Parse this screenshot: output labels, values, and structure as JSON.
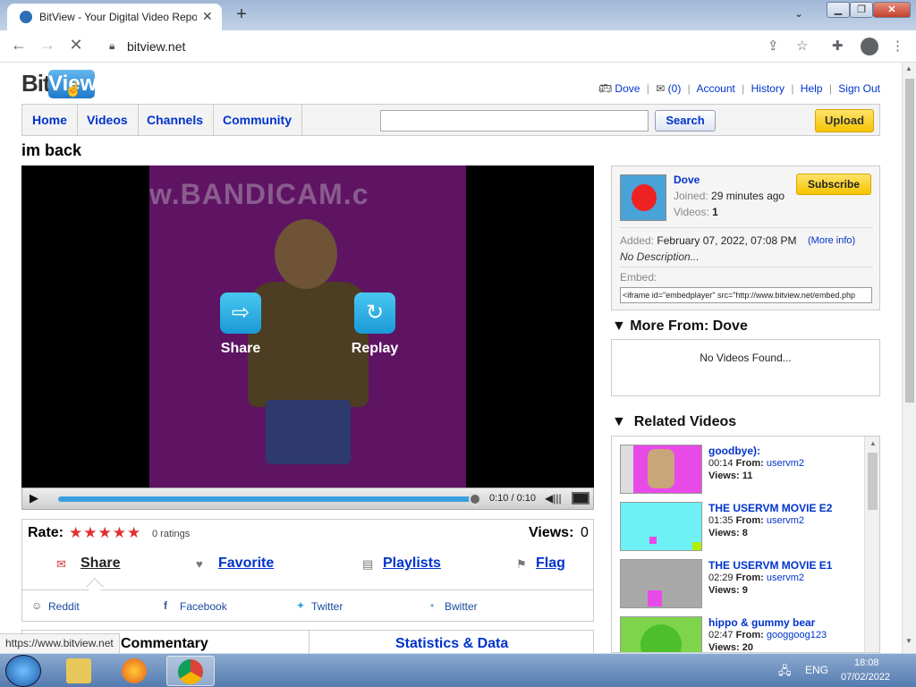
{
  "browser": {
    "tab_title": "BitView - Your Digital Video Repo",
    "url": "bitview.net",
    "status_url": "https://www.bitview.net"
  },
  "header": {
    "logo_bit": "Bit",
    "logo_view": "View",
    "username": "Dove",
    "messages": "(0)",
    "links": [
      "Account",
      "History",
      "Help",
      "Sign Out"
    ]
  },
  "nav": {
    "items": [
      "Home",
      "Videos",
      "Channels",
      "Community"
    ],
    "search_label": "Search",
    "search_value": "",
    "upload_label": "Upload"
  },
  "video": {
    "title": "im back",
    "watermark": "w.BANDICAM.c",
    "overlay_share": "Share",
    "overlay_replay": "Replay",
    "time": "0:10 / 0:10",
    "progress": 1.0
  },
  "info": {
    "rate_label": "Rate:",
    "stars": "★★★★★",
    "ratings": "0 ratings",
    "views_label": "Views:",
    "views": "0",
    "actions": [
      "Share",
      "Favorite",
      "Playlists",
      "Flag"
    ],
    "social": [
      "Reddit",
      "Facebook",
      "Twitter",
      "Bwitter"
    ],
    "tab_commentary": "Commentary",
    "tab_stats": "Statistics & Data"
  },
  "channel": {
    "name": "Dove",
    "joined_label": "Joined:",
    "joined": "29 minutes ago",
    "videos_label": "Videos:",
    "videos": "1",
    "subscribe": "Subscribe",
    "added_label": "Added:",
    "added": "February 07, 2022, 07:08 PM",
    "more_info": "(More info)",
    "description": "No Description...",
    "embed_label": "Embed:",
    "embed_code": "<iframe id=\"embedplayer\" src=\"http://www.bitview.net/embed.php"
  },
  "more_from": {
    "heading": "More From: Dove",
    "empty": "No Videos Found..."
  },
  "related": {
    "heading": "Related Videos",
    "from_label": "From:",
    "views_label": "Views:",
    "items": [
      {
        "title": "goodbye):",
        "duration": "00:14",
        "user": "uservm2",
        "views": "11"
      },
      {
        "title": "THE USERVM MOVIE E2",
        "duration": "01:35",
        "user": "uservm2",
        "views": "8"
      },
      {
        "title": "THE USERVM MOVIE E1",
        "duration": "02:29",
        "user": "uservm2",
        "views": "9"
      },
      {
        "title": "hippo & gummy bear",
        "duration": "02:47",
        "user": "googgoog123",
        "views": "20"
      }
    ]
  },
  "taskbar": {
    "lang": "ENG",
    "time": "18:08",
    "date": "07/02/2022"
  }
}
